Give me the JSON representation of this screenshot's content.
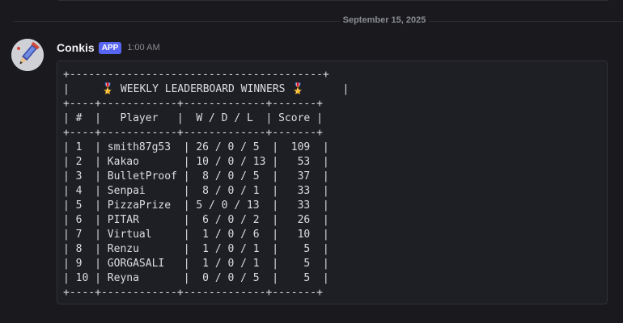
{
  "date_divider": "September 15, 2025",
  "message": {
    "author": "Conkis",
    "badge": "APP",
    "timestamp": "1:00 AM",
    "avatar_icon": "pencil-blade-icon",
    "code_lines": [
      "+----------------------------------------+",
      "|     🎖️ WEEKLY LEADERBOARD WINNERS 🎖️      |",
      "+----+------------+-------------+-------+",
      "| #  |   Player   |  W / D / L  | Score |",
      "+----+------------+-------------+-------+",
      "| 1  | smith87g53  | 26 / 0 / 5  |  109  |",
      "| 2  | Kakao       | 10 / 0 / 13 |   53  |",
      "| 3  | BulletProof |  8 / 0 / 5  |   37  |",
      "| 4  | Senpai      |  8 / 0 / 1  |   33  |",
      "| 5  | PizzaPrize  | 5 / 0 / 13  |   33  |",
      "| 6  | PITAR       |  6 / 0 / 2  |   26  |",
      "| 7  | Virtual     |  1 / 0 / 6  |   10  |",
      "| 8  | Renzu       |  1 / 0 / 1  |    5  |",
      "| 9  | GORGASALI   |  1 / 0 / 1  |    5  |",
      "| 10 | Reyna       |  0 / 0 / 5  |    5  |",
      "+----+------------+-------------+-------+"
    ]
  }
}
